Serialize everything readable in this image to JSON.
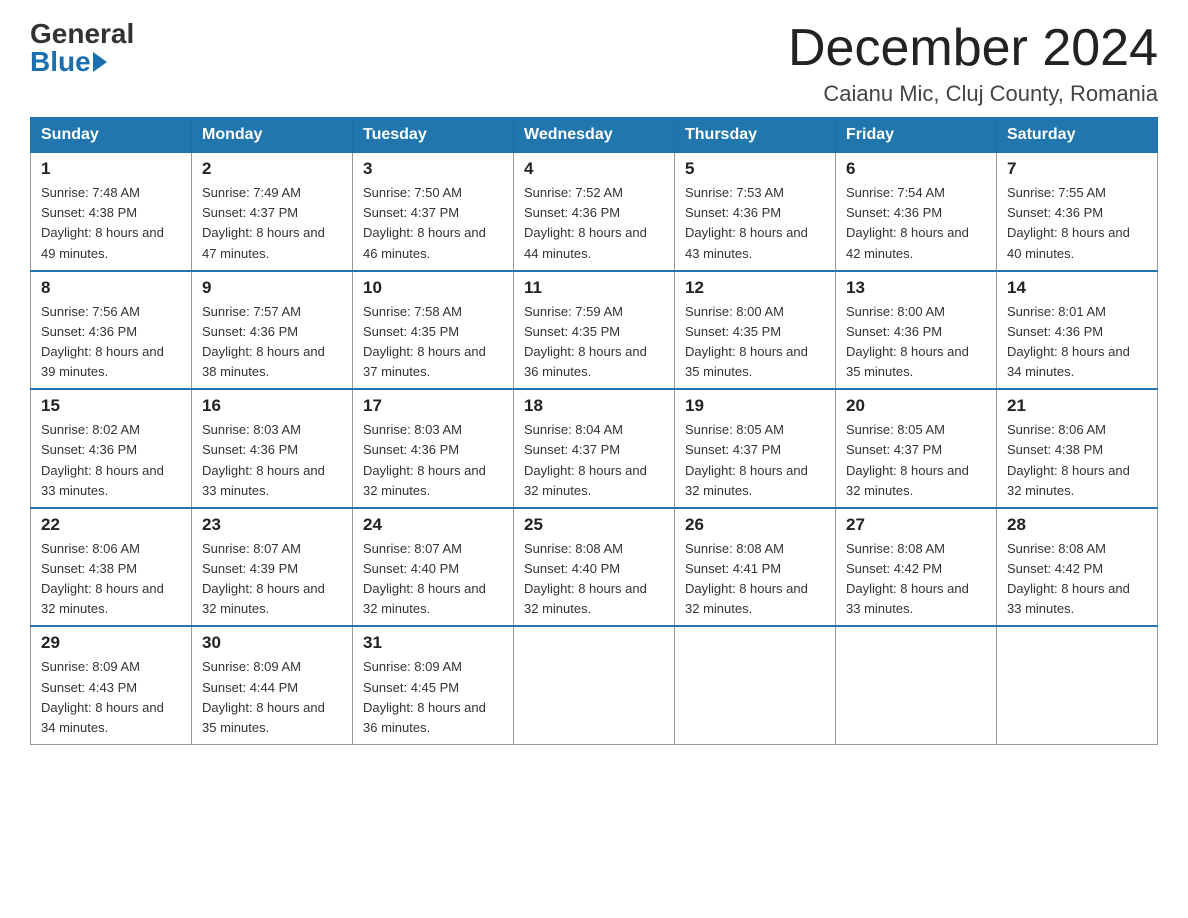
{
  "logo": {
    "general": "General",
    "blue": "Blue"
  },
  "title": "December 2024",
  "location": "Caianu Mic, Cluj County, Romania",
  "weekdays": [
    "Sunday",
    "Monday",
    "Tuesday",
    "Wednesday",
    "Thursday",
    "Friday",
    "Saturday"
  ],
  "weeks": [
    [
      {
        "day": "1",
        "sunrise": "7:48 AM",
        "sunset": "4:38 PM",
        "daylight": "8 hours and 49 minutes."
      },
      {
        "day": "2",
        "sunrise": "7:49 AM",
        "sunset": "4:37 PM",
        "daylight": "8 hours and 47 minutes."
      },
      {
        "day": "3",
        "sunrise": "7:50 AM",
        "sunset": "4:37 PM",
        "daylight": "8 hours and 46 minutes."
      },
      {
        "day": "4",
        "sunrise": "7:52 AM",
        "sunset": "4:36 PM",
        "daylight": "8 hours and 44 minutes."
      },
      {
        "day": "5",
        "sunrise": "7:53 AM",
        "sunset": "4:36 PM",
        "daylight": "8 hours and 43 minutes."
      },
      {
        "day": "6",
        "sunrise": "7:54 AM",
        "sunset": "4:36 PM",
        "daylight": "8 hours and 42 minutes."
      },
      {
        "day": "7",
        "sunrise": "7:55 AM",
        "sunset": "4:36 PM",
        "daylight": "8 hours and 40 minutes."
      }
    ],
    [
      {
        "day": "8",
        "sunrise": "7:56 AM",
        "sunset": "4:36 PM",
        "daylight": "8 hours and 39 minutes."
      },
      {
        "day": "9",
        "sunrise": "7:57 AM",
        "sunset": "4:36 PM",
        "daylight": "8 hours and 38 minutes."
      },
      {
        "day": "10",
        "sunrise": "7:58 AM",
        "sunset": "4:35 PM",
        "daylight": "8 hours and 37 minutes."
      },
      {
        "day": "11",
        "sunrise": "7:59 AM",
        "sunset": "4:35 PM",
        "daylight": "8 hours and 36 minutes."
      },
      {
        "day": "12",
        "sunrise": "8:00 AM",
        "sunset": "4:35 PM",
        "daylight": "8 hours and 35 minutes."
      },
      {
        "day": "13",
        "sunrise": "8:00 AM",
        "sunset": "4:36 PM",
        "daylight": "8 hours and 35 minutes."
      },
      {
        "day": "14",
        "sunrise": "8:01 AM",
        "sunset": "4:36 PM",
        "daylight": "8 hours and 34 minutes."
      }
    ],
    [
      {
        "day": "15",
        "sunrise": "8:02 AM",
        "sunset": "4:36 PM",
        "daylight": "8 hours and 33 minutes."
      },
      {
        "day": "16",
        "sunrise": "8:03 AM",
        "sunset": "4:36 PM",
        "daylight": "8 hours and 33 minutes."
      },
      {
        "day": "17",
        "sunrise": "8:03 AM",
        "sunset": "4:36 PM",
        "daylight": "8 hours and 32 minutes."
      },
      {
        "day": "18",
        "sunrise": "8:04 AM",
        "sunset": "4:37 PM",
        "daylight": "8 hours and 32 minutes."
      },
      {
        "day": "19",
        "sunrise": "8:05 AM",
        "sunset": "4:37 PM",
        "daylight": "8 hours and 32 minutes."
      },
      {
        "day": "20",
        "sunrise": "8:05 AM",
        "sunset": "4:37 PM",
        "daylight": "8 hours and 32 minutes."
      },
      {
        "day": "21",
        "sunrise": "8:06 AM",
        "sunset": "4:38 PM",
        "daylight": "8 hours and 32 minutes."
      }
    ],
    [
      {
        "day": "22",
        "sunrise": "8:06 AM",
        "sunset": "4:38 PM",
        "daylight": "8 hours and 32 minutes."
      },
      {
        "day": "23",
        "sunrise": "8:07 AM",
        "sunset": "4:39 PM",
        "daylight": "8 hours and 32 minutes."
      },
      {
        "day": "24",
        "sunrise": "8:07 AM",
        "sunset": "4:40 PM",
        "daylight": "8 hours and 32 minutes."
      },
      {
        "day": "25",
        "sunrise": "8:08 AM",
        "sunset": "4:40 PM",
        "daylight": "8 hours and 32 minutes."
      },
      {
        "day": "26",
        "sunrise": "8:08 AM",
        "sunset": "4:41 PM",
        "daylight": "8 hours and 32 minutes."
      },
      {
        "day": "27",
        "sunrise": "8:08 AM",
        "sunset": "4:42 PM",
        "daylight": "8 hours and 33 minutes."
      },
      {
        "day": "28",
        "sunrise": "8:08 AM",
        "sunset": "4:42 PM",
        "daylight": "8 hours and 33 minutes."
      }
    ],
    [
      {
        "day": "29",
        "sunrise": "8:09 AM",
        "sunset": "4:43 PM",
        "daylight": "8 hours and 34 minutes."
      },
      {
        "day": "30",
        "sunrise": "8:09 AM",
        "sunset": "4:44 PM",
        "daylight": "8 hours and 35 minutes."
      },
      {
        "day": "31",
        "sunrise": "8:09 AM",
        "sunset": "4:45 PM",
        "daylight": "8 hours and 36 minutes."
      },
      null,
      null,
      null,
      null
    ]
  ]
}
